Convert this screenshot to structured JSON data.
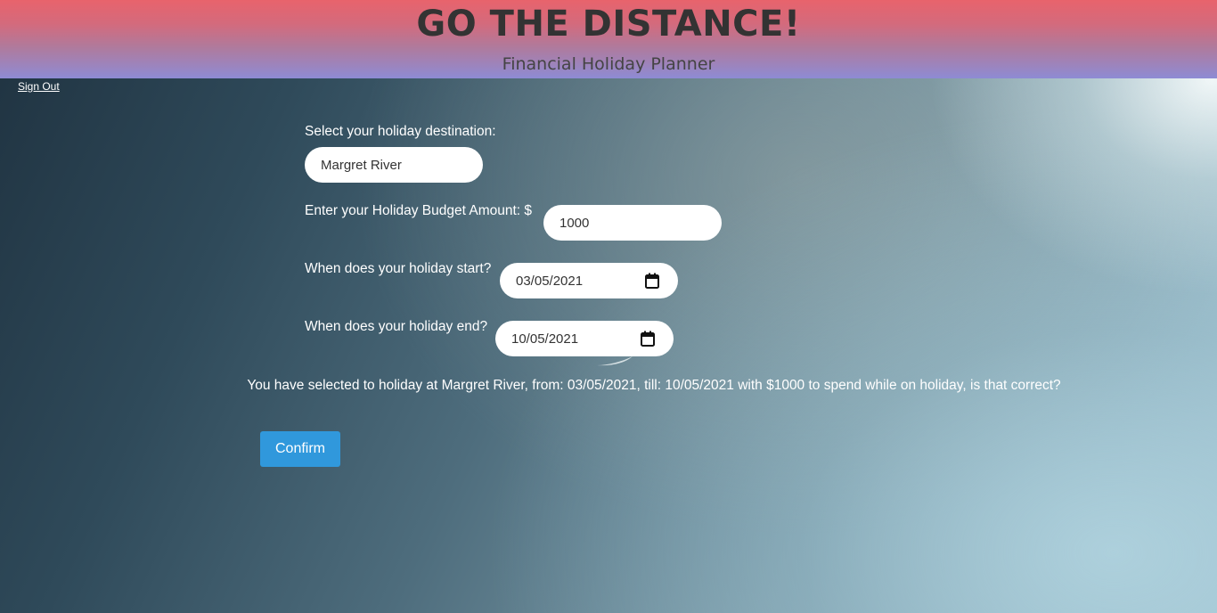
{
  "header": {
    "title": "GO THE DISTANCE!",
    "subtitle": "Financial Holiday Planner"
  },
  "nav": {
    "sign_out_label": "Sign Out"
  },
  "form": {
    "destination": {
      "label": "Select your holiday destination:",
      "value": "Margret River"
    },
    "budget": {
      "label": "Enter your Holiday Budget Amount: $",
      "value": "1000"
    },
    "start_date": {
      "label": "When does your holiday start?",
      "value": "03/05/2021",
      "icon": "calendar-icon"
    },
    "end_date": {
      "label": "When does your holiday end?",
      "value": "10/05/2021",
      "icon": "calendar-icon"
    },
    "summary": "You have selected to holiday at Margret River, from: 03/05/2021, till: 10/05/2021 with $1000 to spend while on holiday, is that correct?",
    "confirm_label": "Confirm"
  },
  "colors": {
    "header_top": "#e8636c",
    "header_bottom": "#8e8bd4",
    "confirm_button": "#3098dc",
    "text": "#ffffff"
  }
}
